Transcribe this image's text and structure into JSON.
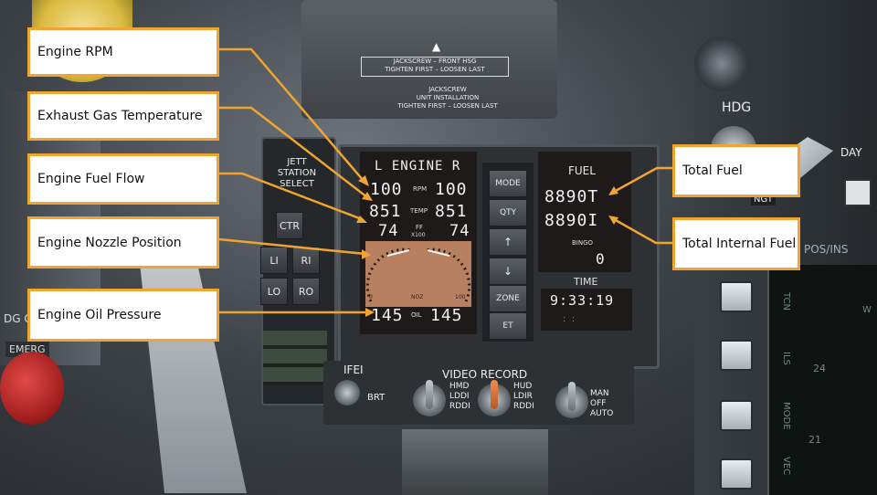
{
  "panel": {
    "engine_header": "L  ENGINE  R",
    "rpm": {
      "left": "100",
      "label": "RPM",
      "right": "100"
    },
    "temp": {
      "left": "851",
      "label": "TEMP",
      "right": "851"
    },
    "ff": {
      "left": "74",
      "label": "FF",
      "unit": "X100",
      "right": "74"
    },
    "noz": {
      "label": "NOZ",
      "scale_min": "0",
      "scale_max": "100"
    },
    "oil": {
      "left": "145",
      "label": "OIL",
      "right": "145"
    },
    "fuel_header": "FUEL",
    "fuel_total": "8890T",
    "fuel_internal": "8890I",
    "bingo_label": "BINGO",
    "bingo_value": "0",
    "time_label": "TIME",
    "time_value": "9:33:19",
    "time_sub": ":  :",
    "buttons": [
      "MODE",
      "QTY",
      "↑",
      "↓",
      "ZONE",
      "ET"
    ]
  },
  "cockpit": {
    "jett": "JETT\nSTATION\nSELECT",
    "stations": [
      "CTR",
      "LI",
      "RI",
      "LO",
      "RO"
    ],
    "jackscrew1_line1": "JACKSCREW – FRONT HSG",
    "jackscrew1_line2": "TIGHTEN FIRST – LOOSEN LAST",
    "jackscrew2_line1": "JACKSCREW",
    "jackscrew2_line2": "UNIT INSTALLATION",
    "jackscrew2_line3": "TIGHTEN FIRST – LOOSEN LAST",
    "hdg": "HDG",
    "day": "DAY",
    "ngt": "NGT",
    "pos_ins": "POS/INS",
    "ifei": "IFEI",
    "brt": "BRT",
    "video_record": "VIDEO RECORD",
    "vr_left": [
      "HMD",
      "LDDI",
      "RDDI"
    ],
    "vr_mid": [
      "HUD",
      "LDIR",
      "RDDI"
    ],
    "vr_right": [
      "MAN",
      "OFF",
      "AUTO"
    ],
    "mfd_labels": [
      "TCN",
      "ILS",
      "MODE",
      "VEC"
    ],
    "mfd_values": [
      "W",
      "24",
      "21"
    ],
    "emerg": "EMERG",
    "gear": "DG GEAR"
  },
  "callouts": [
    "Engine RPM",
    "Exhaust Gas Temperature",
    "Engine Fuel Flow",
    "Engine Nozzle Position",
    "Engine Oil Pressure",
    "Total Fuel",
    "Total Internal Fuel"
  ],
  "colors": {
    "callout_border": "#f0a431",
    "leader": "#f0a431",
    "ifei_bg": "#1d1a19",
    "nozzle_gauge": "#b78061"
  }
}
